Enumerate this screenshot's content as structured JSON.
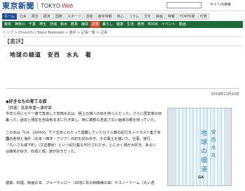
{
  "header": {
    "logo_main": "東京新聞",
    "logo_sub": "TOKYO",
    "logo_web": "Web",
    "search_placeholder": "",
    "sitemap": "サイト内検索"
  },
  "nav1": [
    "ホーム",
    "社会",
    "政治",
    "経済",
    "国際",
    "スポーツ",
    "芸能",
    "東京特報",
    "核心",
    "コラム",
    "文化",
    "映画",
    "特報",
    "TOKYO発",
    "代表"
  ],
  "nav1_active": 0,
  "nav2": [
    "東京",
    "神奈川",
    "千葉",
    "埼玉",
    "茨城",
    "栃木",
    "群馬",
    "静岡",
    "読書",
    "暮らし",
    "健康",
    "生活",
    "教育",
    "BOOK",
    "イベント",
    "動画"
  ],
  "nav2_selected": 8,
  "breadcrumb": "トップ > Chunichi / Tokyo Bookweb > 書評 > 記事一覧 > 記事",
  "section_label": "【書評】",
  "article": {
    "title": "地球の細道　安西　水丸　著",
    "date": "2014年11月23日",
    "sub_head": "◆好きなもの育てる旅",
    "reviewer": "［評者］荻原魚雷＝書評家",
    "paragraphs": [
      "今年三月に七十一歳で急逝した安西水丸は、極上の旅人の目を持つ人だった。さらに歴史家の目も",
      "あった。過去と現在を自由気ままに行き来し、時に細部も見逃さない画家の眼を持っていた。",
      "この本は「GA　JAPAN」で十五年にわたって連載していた九十三篇の紀行文＋イラスト集である。",
      "国内各地と海外（北米・西洋・アジア）の町を訪ね歩き、その風土を描いた。仕事、旅行、",
      "「ちいさな城下町」（文芸春秋）という紀行集も刊行されたが、とにかく城が大好き。あるい",
      "は路地が好き。石垣と堀、旅が好きだった。",
      "建築、料理、映画の本、ブルーウィロー（白地に青の柳模様の皿）やスノードーム（丸い透"
    ]
  }
}
